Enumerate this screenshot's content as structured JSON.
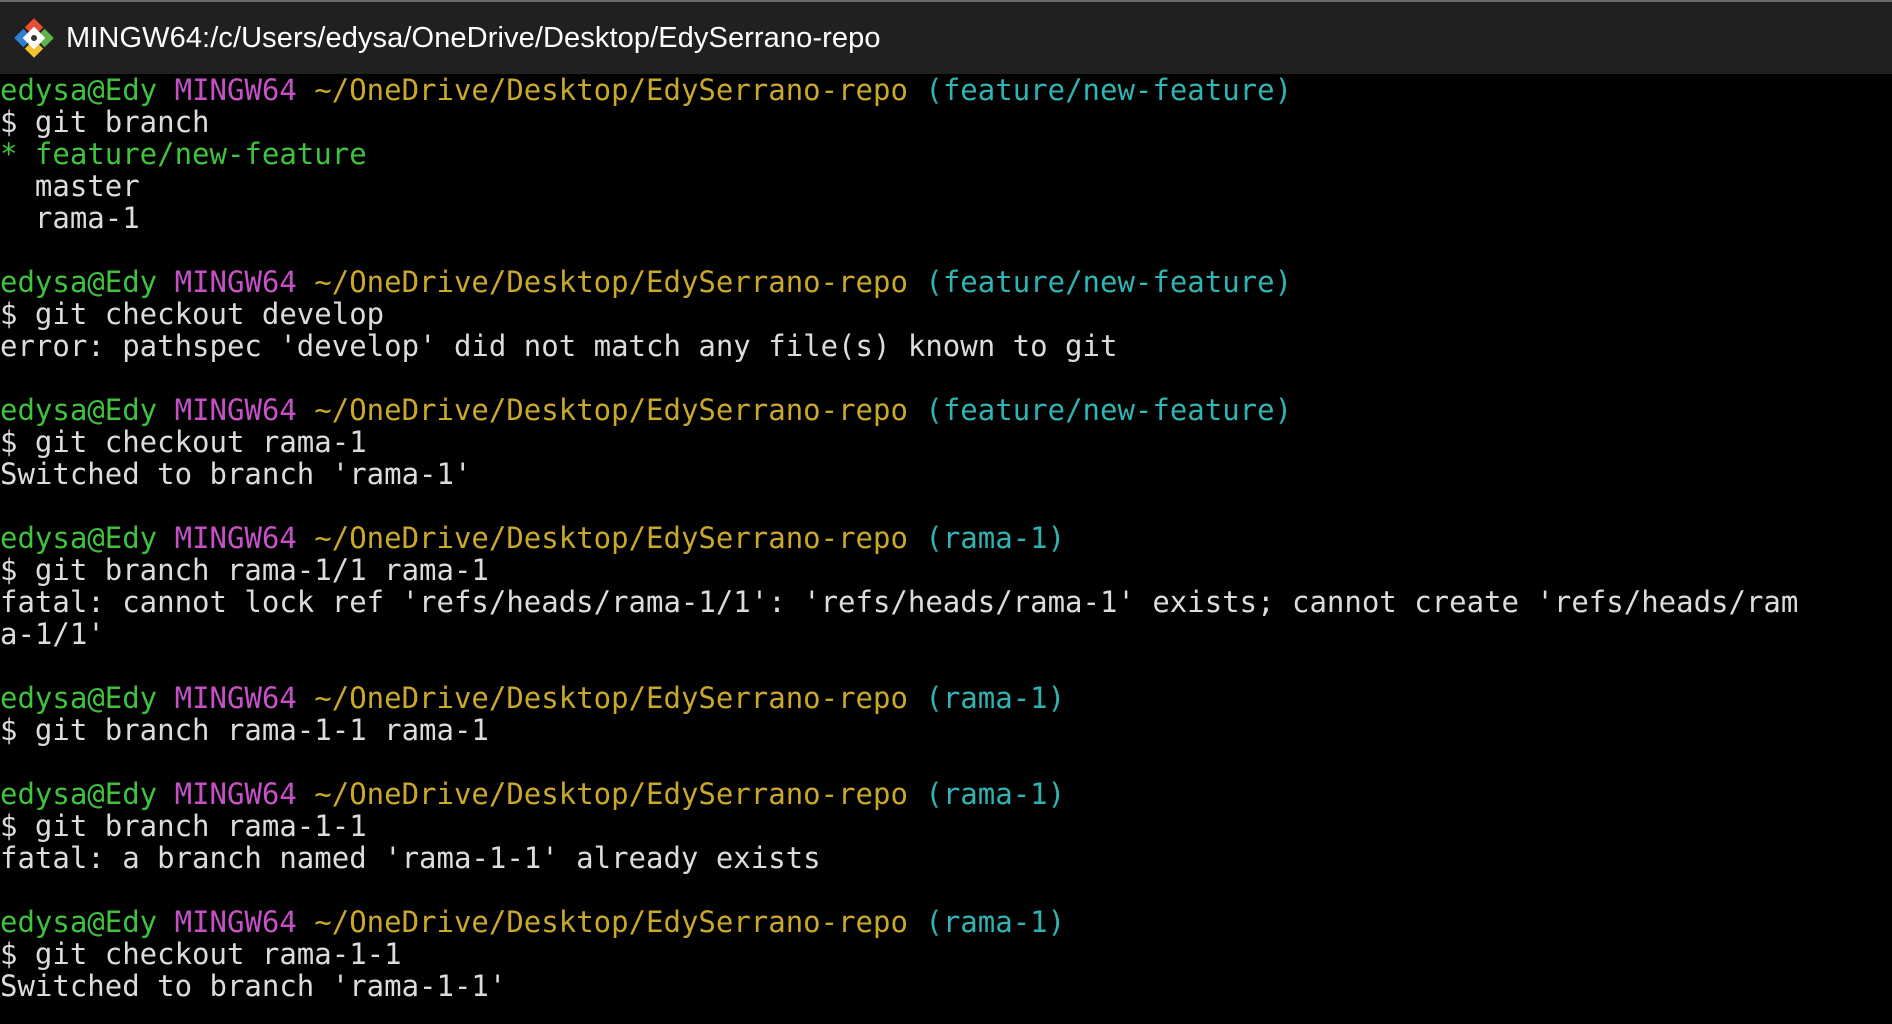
{
  "window": {
    "title": "MINGW64:/c/Users/edysa/OneDrive/Desktop/EdySerrano-repo",
    "icon": "git-bash-icon"
  },
  "colors": {
    "user": "#3fc33f",
    "system": "#c651c6",
    "path": "#c9a82a",
    "branch": "#2fb3b3",
    "text": "#dcdcdc",
    "background": "#000000"
  },
  "terminal": {
    "blocks": [
      {
        "prompt": {
          "user": "edysa@Edy",
          "system": "MINGW64",
          "path": "~/OneDrive/Desktop/EdySerrano-repo",
          "branch": "(feature/new-feature)"
        },
        "command": "$ git branch",
        "output": [
          {
            "text": "* feature/new-feature",
            "style": "current"
          },
          {
            "text": "  master",
            "style": "text"
          },
          {
            "text": "  rama-1",
            "style": "text"
          }
        ]
      },
      {
        "prompt": {
          "user": "edysa@Edy",
          "system": "MINGW64",
          "path": "~/OneDrive/Desktop/EdySerrano-repo",
          "branch": "(feature/new-feature)"
        },
        "command": "$ git checkout develop",
        "output": [
          {
            "text": "error: pathspec 'develop' did not match any file(s) known to git",
            "style": "text"
          }
        ]
      },
      {
        "prompt": {
          "user": "edysa@Edy",
          "system": "MINGW64",
          "path": "~/OneDrive/Desktop/EdySerrano-repo",
          "branch": "(feature/new-feature)"
        },
        "command": "$ git checkout rama-1",
        "output": [
          {
            "text": "Switched to branch 'rama-1'",
            "style": "text"
          }
        ]
      },
      {
        "prompt": {
          "user": "edysa@Edy",
          "system": "MINGW64",
          "path": "~/OneDrive/Desktop/EdySerrano-repo",
          "branch": "(rama-1)"
        },
        "command": "$ git branch rama-1/1 rama-1",
        "output": [
          {
            "text": "fatal: cannot lock ref 'refs/heads/rama-1/1': 'refs/heads/rama-1' exists; cannot create 'refs/heads/ram",
            "style": "text"
          },
          {
            "text": "a-1/1'",
            "style": "text"
          }
        ]
      },
      {
        "prompt": {
          "user": "edysa@Edy",
          "system": "MINGW64",
          "path": "~/OneDrive/Desktop/EdySerrano-repo",
          "branch": "(rama-1)"
        },
        "command": "$ git branch rama-1-1 rama-1",
        "output": []
      },
      {
        "prompt": {
          "user": "edysa@Edy",
          "system": "MINGW64",
          "path": "~/OneDrive/Desktop/EdySerrano-repo",
          "branch": "(rama-1)"
        },
        "command": "$ git branch rama-1-1",
        "output": [
          {
            "text": "fatal: a branch named 'rama-1-1' already exists",
            "style": "text"
          }
        ]
      },
      {
        "prompt": {
          "user": "edysa@Edy",
          "system": "MINGW64",
          "path": "~/OneDrive/Desktop/EdySerrano-repo",
          "branch": "(rama-1)"
        },
        "command": "$ git checkout rama-1-1",
        "output": [
          {
            "text": "Switched to branch 'rama-1-1'",
            "style": "text"
          }
        ]
      }
    ]
  }
}
